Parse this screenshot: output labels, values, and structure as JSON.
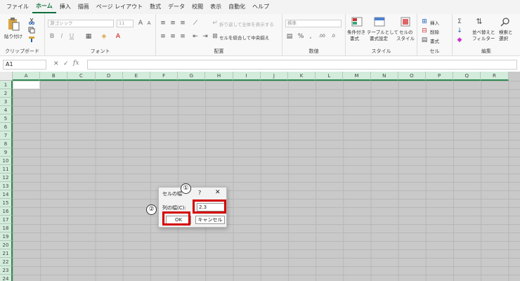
{
  "menu": {
    "tabs": [
      "ファイル",
      "ホーム",
      "挿入",
      "描画",
      "ページ レイアウト",
      "数式",
      "データ",
      "校閲",
      "表示",
      "自動化",
      "ヘルプ"
    ],
    "active_index": 1
  },
  "ribbon": {
    "clipboard": {
      "paste_label": "貼り付け",
      "group_label": "クリップボード"
    },
    "font": {
      "font_name": "游ゴシック",
      "font_size": "11",
      "group_label": "フォント"
    },
    "alignment": {
      "wrap_label": "折り返して全体を表示する",
      "merge_label": "セルを結合して中央揃え",
      "group_label": "配置"
    },
    "number": {
      "format": "標準",
      "group_label": "数値"
    },
    "styles": {
      "conditional_label_1": "条件付き",
      "conditional_label_2": "書式",
      "table_label_1": "テーブルとして",
      "table_label_2": "書式設定",
      "cellstyle_label_1": "セルの",
      "cellstyle_label_2": "スタイル",
      "group_label": "スタイル"
    },
    "cells": {
      "insert_label": "挿入",
      "delete_label": "削除",
      "format_label": "書式",
      "group_label": "セル"
    },
    "editing": {
      "sort_label_1": "並べ替えと",
      "sort_label_2": "フィルター",
      "find_label_1": "検索と",
      "find_label_2": "選択",
      "group_label": "編集"
    }
  },
  "formula_bar": {
    "name_box": "A1",
    "fx": "fx"
  },
  "grid": {
    "columns": [
      "A",
      "B",
      "C",
      "D",
      "E",
      "F",
      "G",
      "H",
      "I",
      "J",
      "K",
      "L",
      "M",
      "N",
      "O",
      "P",
      "Q",
      "R"
    ],
    "rows": [
      "1",
      "2",
      "3",
      "4",
      "5",
      "6",
      "7",
      "8",
      "9",
      "10",
      "11",
      "12",
      "13",
      "14",
      "15",
      "16",
      "17",
      "18",
      "19",
      "20",
      "21",
      "22",
      "23",
      "24"
    ]
  },
  "dialog": {
    "title": "セルの幅",
    "help": "?",
    "close": "✕",
    "field_label": "列の幅(C):",
    "field_value": "2.3",
    "ok_label": "OK",
    "cancel_label": "キャンセル"
  },
  "annotations": {
    "badge_1": "①",
    "badge_2": "②",
    "color": "#d40000"
  },
  "colors": {
    "accent": "#0f6f3a",
    "header_bg": "#d3ecdc",
    "sheet_bg": "#c9c9c9"
  }
}
